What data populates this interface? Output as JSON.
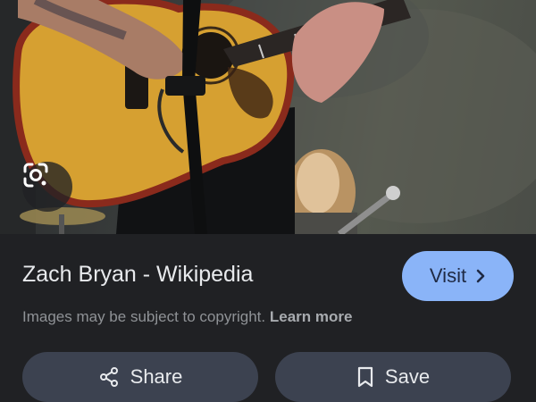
{
  "image": {
    "description_icon": "photo-of-guitarist",
    "lens_icon": "google-lens-icon"
  },
  "result": {
    "title": "Zach Bryan - Wikipedia",
    "visit_label": "Visit",
    "visit_icon": "chevron-right-icon",
    "copyright_text": "Images may be subject to copyright.",
    "learn_more": "Learn more"
  },
  "actions": {
    "share_label": "Share",
    "share_icon": "share-icon",
    "save_label": "Save",
    "save_icon": "bookmark-icon"
  },
  "colors": {
    "background": "#202124",
    "visit_button": "#8ab4f8",
    "action_button": "#3c4250"
  }
}
